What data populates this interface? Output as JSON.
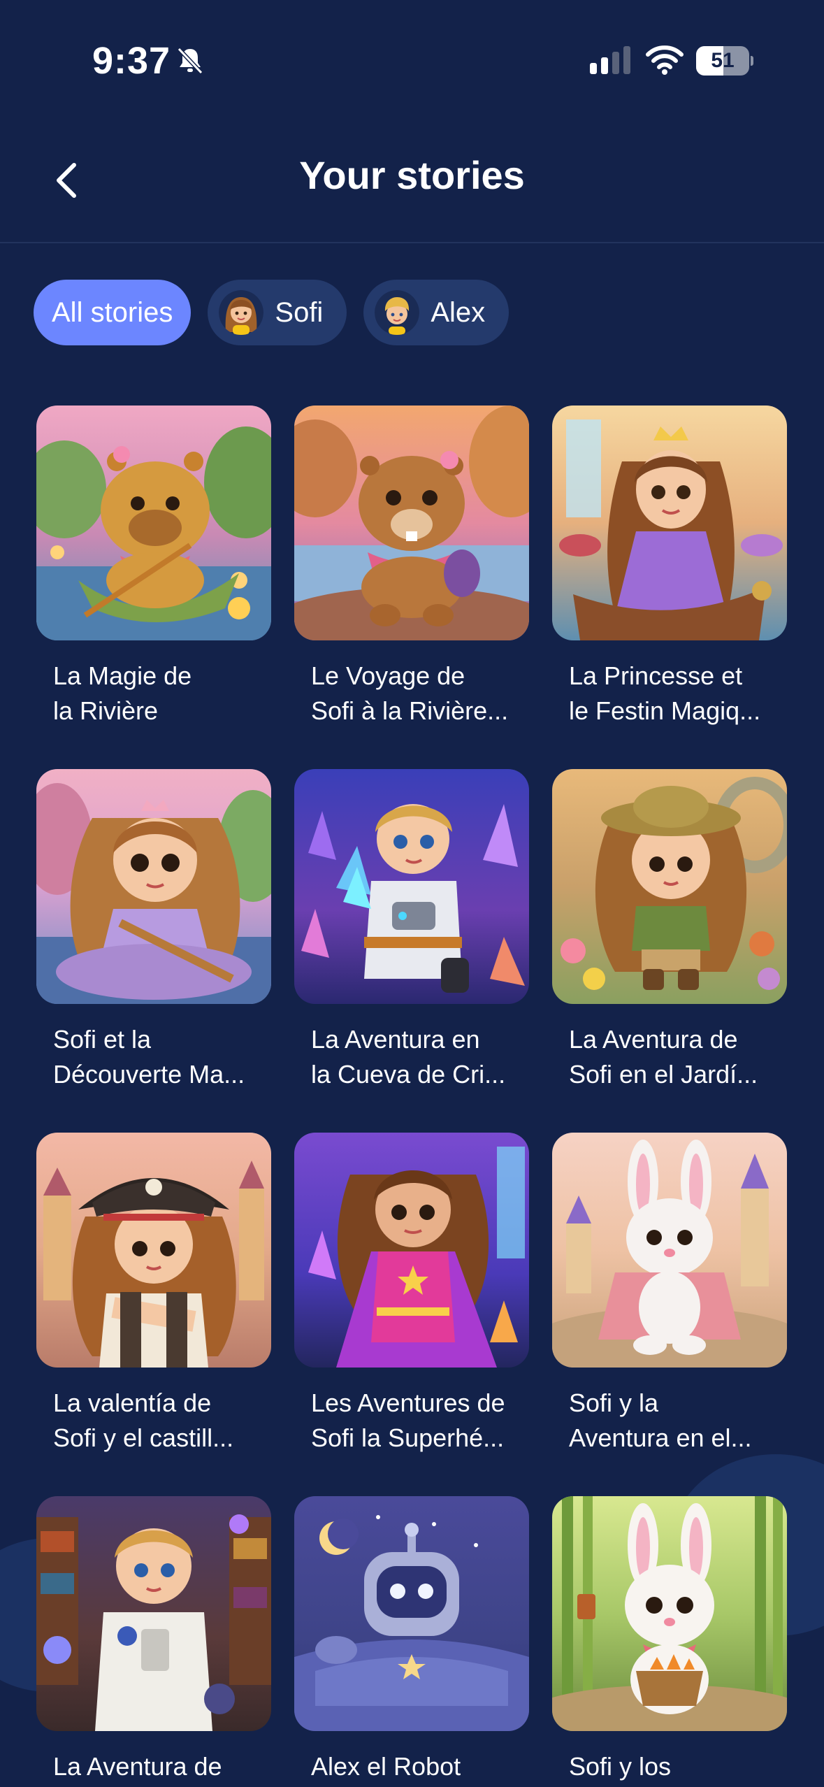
{
  "status_bar": {
    "time": "9:37",
    "battery_level": "51",
    "battery_fraction": 0.51
  },
  "header": {
    "title": "Your stories"
  },
  "filters": [
    {
      "label": "All stories",
      "active": true
    },
    {
      "label": "Sofi",
      "active": false
    },
    {
      "label": "Alex",
      "active": false
    }
  ],
  "stories": [
    {
      "title": "La Magie de\nla Rivière",
      "icon": "capybara-in-boat-illustration"
    },
    {
      "title": "Le Voyage de\nSofi à la Rivière...",
      "icon": "beaver-by-river-illustration"
    },
    {
      "title": "La Princesse et\nle Festin Magiq...",
      "icon": "princess-in-boat-illustration"
    },
    {
      "title": "Sofi et la\nDécouverte Ma...",
      "icon": "princess-rowing-illustration"
    },
    {
      "title": "La Aventura en\nla Cueva de Cri...",
      "icon": "astronaut-crystal-cave-illustration"
    },
    {
      "title": "La Aventura de\nSofi en el Jardí...",
      "icon": "explorer-garden-illustration"
    },
    {
      "title": "La valentía de\nSofi y el castill...",
      "icon": "pirate-girl-illustration"
    },
    {
      "title": "Les Aventures de\nSofi la Superhé...",
      "icon": "superhero-girl-illustration"
    },
    {
      "title": "Sofi y la\nAventura en el...",
      "icon": "bunny-castle-illustration"
    },
    {
      "title": "La Aventura de",
      "icon": "astronaut-library-illustration"
    },
    {
      "title": "Alex el Robot",
      "icon": "robot-bed-illustration"
    },
    {
      "title": "Sofi y los",
      "icon": "bunny-bamboo-illustration"
    }
  ],
  "colors": {
    "background": "#13224a",
    "chip_active": "#6c86ff",
    "chip_inactive": "#243a6c"
  }
}
